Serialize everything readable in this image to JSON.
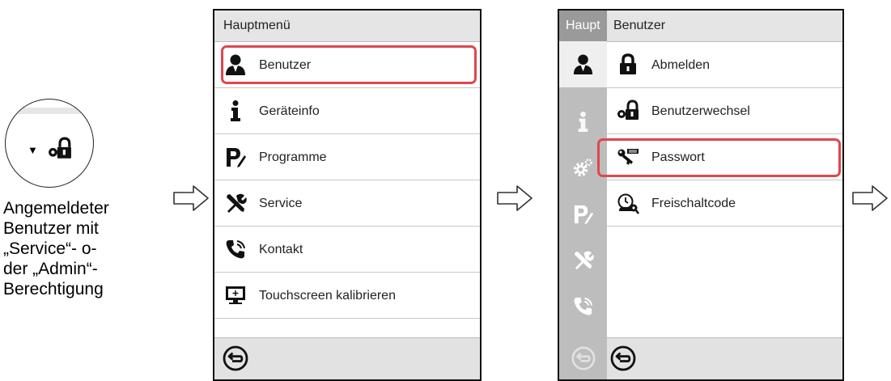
{
  "caption": {
    "lines": [
      "Angemeldeter",
      "Benutzer mit",
      "„Service“- o-",
      "der „Admin“-",
      "Berechtigung"
    ]
  },
  "screen1": {
    "title": "Hauptmenü",
    "items": [
      {
        "label": "Benutzer",
        "icon": "user-icon"
      },
      {
        "label": "Geräteinfo",
        "icon": "info-icon"
      },
      {
        "label": "Programme",
        "icon": "programs-icon"
      },
      {
        "label": "Service",
        "icon": "service-tools-icon"
      },
      {
        "label": "Kontakt",
        "icon": "phone-icon"
      },
      {
        "label": "Touchscreen kalibrieren",
        "icon": "touchscreen-icon"
      }
    ],
    "highlighted": "Benutzer"
  },
  "screen2": {
    "side_title": "Haupt",
    "title": "Benutzer",
    "items": [
      {
        "label": "Abmelden",
        "icon": "lock-icon"
      },
      {
        "label": "Benutzerwechsel",
        "icon": "user-switch-icon"
      },
      {
        "label": "Passwort",
        "icon": "password-key-icon"
      },
      {
        "label": "Freischaltcode",
        "icon": "unlock-code-icon"
      }
    ],
    "highlighted": "Passwort"
  },
  "colors": {
    "highlight": "#e0474c",
    "sidebar": "#bdbdbd",
    "titlebar": "#e5e5e5"
  }
}
